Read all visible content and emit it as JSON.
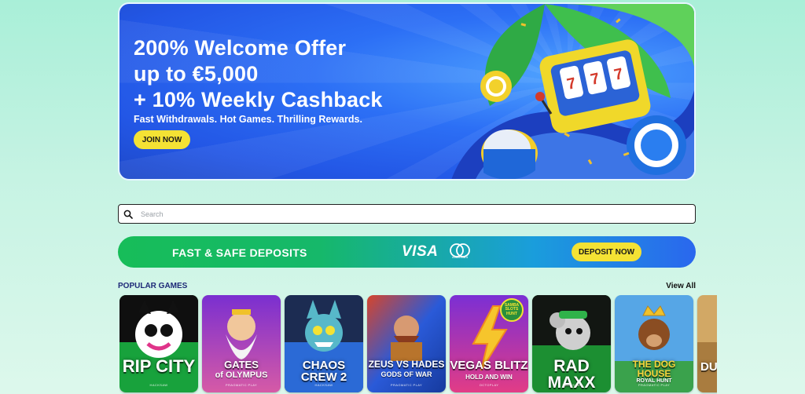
{
  "hero": {
    "line1": "200% Welcome Offer",
    "line2": "up to €5,000",
    "line3": "+ 10% Weekly Cashback",
    "subtitle": "Fast Withdrawals. Hot Games. Thrilling Rewards.",
    "cta_label": "JOIN NOW"
  },
  "search": {
    "placeholder": "Search",
    "icon": "search-icon"
  },
  "deposit": {
    "title": "FAST & SAFE DEPOSITS",
    "visa_label": "VISA",
    "mastercard_label": "mastercard",
    "cta_label": "DEPOSIT NOW"
  },
  "popular": {
    "title": "POPULAR GAMES",
    "view_all": "View All",
    "games": [
      {
        "title": "RIP CITY",
        "subtitle": "",
        "provider": "HACKSAW",
        "color": "#19a33d"
      },
      {
        "title": "GATES",
        "subtitle": "of OLYMPUS",
        "provider": "PRAGMATIC PLAY",
        "color": "#8e3bd6"
      },
      {
        "title": "CHAOS CREW 2",
        "subtitle": "",
        "provider": "HACKSAW",
        "color": "#2c5fd9"
      },
      {
        "title": "ZEUS VS HADES",
        "subtitle": "GODS OF WAR",
        "provider": "PRAGMATIC PLAY",
        "color": "#1f4fc2"
      },
      {
        "title": "VEGAS BLITZ",
        "subtitle": "HOLD AND WIN",
        "provider": "OCTOPLAY",
        "color": "#9b2fd0",
        "badge": "SAMBA SLOTS HUNT"
      },
      {
        "title": "RAD MAXX",
        "subtitle": "",
        "provider": "HACKSAW",
        "color": "#1e8f34"
      },
      {
        "title": "THE DOG",
        "subtitle": "HOUSE",
        "extra": "ROYAL HUNT",
        "provider": "PRAGMATIC PLAY",
        "color": "#3f8fd8"
      },
      {
        "title": "DU",
        "subtitle": "",
        "provider": "",
        "color": "#c89a55"
      }
    ]
  }
}
